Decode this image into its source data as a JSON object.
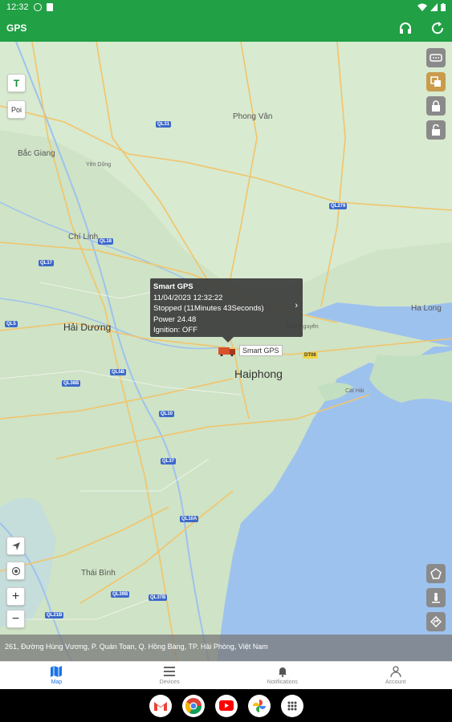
{
  "status": {
    "time": "12:32"
  },
  "appbar": {
    "title": "GPS",
    "icons": [
      "headset-icon",
      "refresh-icon"
    ]
  },
  "map": {
    "places": [
      {
        "name": "Phong Vân"
      },
      {
        "name": "Bắc Giang"
      },
      {
        "name": "Yên Dũng"
      },
      {
        "name": "Chí Linh"
      },
      {
        "name": "Hải Dương"
      },
      {
        "name": "Haiphong"
      },
      {
        "name": "Ha Long"
      },
      {
        "name": "Cát Hải"
      },
      {
        "name": "Thái Bình"
      },
      {
        "name": "Thủy Nguyên"
      }
    ],
    "routes": [
      "QL31",
      "QL279",
      "QL18",
      "QL17",
      "QL5",
      "QL10",
      "QL38B",
      "QL37",
      "QL10A",
      "QL39B",
      "QL37B",
      "QL21B",
      "QL5B",
      "DT06"
    ],
    "left_controls": {
      "text_tool": "T",
      "poi": "Poi"
    },
    "zoom": {
      "in": "+",
      "out": "−"
    }
  },
  "popup": {
    "title": "Smart GPS",
    "datetime": "11/04/2023 12:32:22",
    "status": "Stopped   (11Minutes 43Seconds)",
    "power": "Power   24.48",
    "ignition": "Ignition:  OFF"
  },
  "vehicle_label": "Smart GPS",
  "address": "261, Đường Hùng Vương, P. Quán Toan, Q. Hồng Bàng, TP. Hải Phòng, Việt Nam",
  "nav": [
    {
      "label": "Map"
    },
    {
      "label": "Devices"
    },
    {
      "label": "Notifications"
    },
    {
      "label": "Account"
    }
  ],
  "taskbar": [
    "Gmail",
    "Chrome",
    "YouTube",
    "Photos",
    "Apps"
  ],
  "colors": {
    "accent": "#21a045",
    "sea": "#9ec2ee",
    "land": "#cfe3c6"
  }
}
